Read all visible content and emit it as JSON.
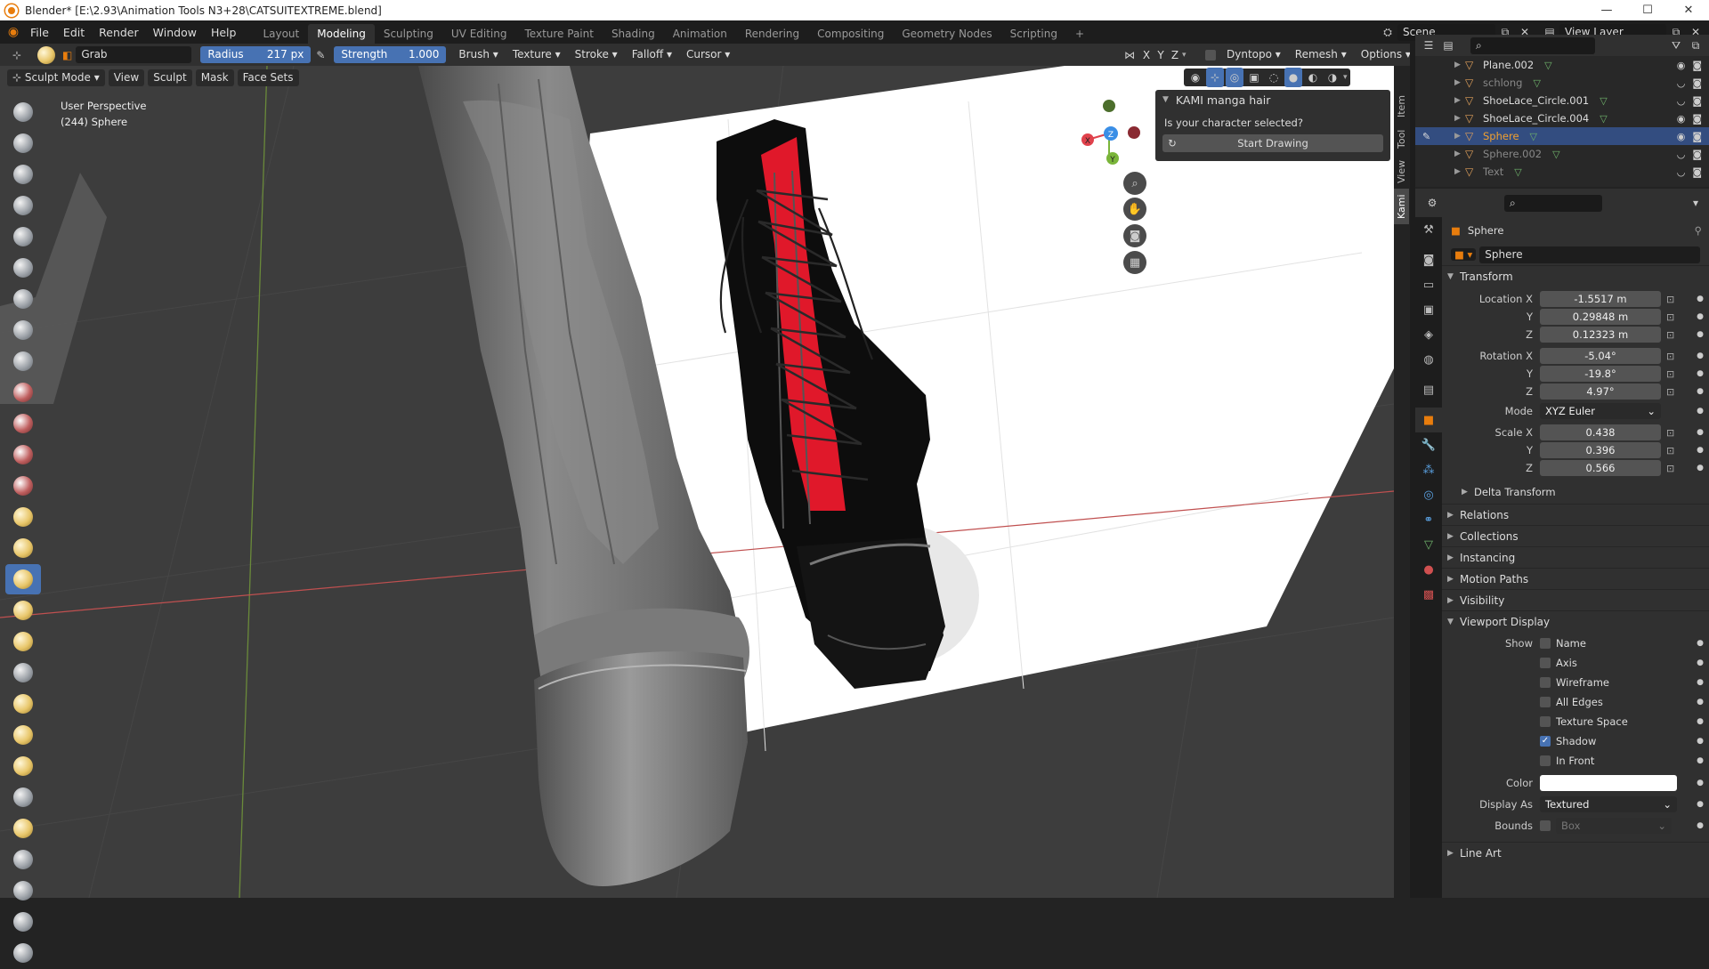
{
  "window": {
    "title": "Blender* [E:\\2.93\\Animation Tools N3+28\\CATSUITEXTREME.blend]",
    "min": "—",
    "max": "☐",
    "close": "✕"
  },
  "menus": [
    "File",
    "Edit",
    "Render",
    "Window",
    "Help"
  ],
  "workspaces": [
    "Layout",
    "Modeling",
    "Sculpting",
    "UV Editing",
    "Texture Paint",
    "Shading",
    "Animation",
    "Rendering",
    "Compositing",
    "Geometry Nodes",
    "Scripting",
    "+"
  ],
  "active_workspace": 1,
  "scene": {
    "name": "Scene",
    "view_layer": "View Layer"
  },
  "tool_header": {
    "brush_name": "Grab",
    "radius_label": "Radius",
    "radius_value": "217 px",
    "strength_label": "Strength",
    "strength_value": "1.000",
    "menus": [
      "Brush",
      "Texture",
      "Stroke",
      "Falloff",
      "Cursor"
    ],
    "axes": [
      "X",
      "Y",
      "Z"
    ],
    "right_menus": [
      "Dyntopo",
      "Remesh",
      "Options"
    ]
  },
  "mode_header": {
    "mode": "Sculpt Mode",
    "menus": [
      "View",
      "Sculpt",
      "Mask",
      "Face Sets"
    ]
  },
  "viewport": {
    "perspective": "User Perspective",
    "object_info": "(244) Sphere"
  },
  "n_panel": {
    "tabs": [
      "Item",
      "Tool",
      "View",
      "Kami"
    ],
    "active_tab": 3,
    "title": "KAMI manga hair",
    "question": "Is your character selected?",
    "button": "Start Drawing"
  },
  "gizmo": {
    "x": "X",
    "y": "Y",
    "z": "Z",
    "x_color": "#e0424c",
    "y_color": "#7ab53a",
    "z_color": "#3a8ee6"
  },
  "outliner": {
    "rows": [
      {
        "name": "Plane.002",
        "dim": false,
        "selected": false
      },
      {
        "name": "schlong",
        "dim": true,
        "selected": false
      },
      {
        "name": "ShoeLace_Circle.001",
        "dim": false,
        "selected": false
      },
      {
        "name": "ShoeLace_Circle.004",
        "dim": false,
        "selected": false
      },
      {
        "name": "Sphere",
        "dim": false,
        "selected": true
      },
      {
        "name": "Sphere.002",
        "dim": true,
        "selected": false
      },
      {
        "name": "Text",
        "dim": true,
        "selected": false
      }
    ]
  },
  "properties": {
    "object_name": "Sphere",
    "data_name": "Sphere",
    "transform_title": "Transform",
    "location": {
      "label": "Location X",
      "x": "-1.5517 m",
      "y": "0.29848 m",
      "z": "0.12323 m"
    },
    "rotation": {
      "label": "Rotation X",
      "x": "-5.04°",
      "y": "-19.8°",
      "z": "4.97°"
    },
    "mode_label": "Mode",
    "mode_value": "XYZ Euler",
    "scale": {
      "label": "Scale X",
      "x": "0.438",
      "y": "0.396",
      "z": "0.566"
    },
    "y_label": "Y",
    "z_label": "Z",
    "delta": "Delta Transform",
    "sections": [
      "Relations",
      "Collections",
      "Instancing",
      "Motion Paths",
      "Visibility"
    ],
    "viewport_display": "Viewport Display",
    "show_label": "Show",
    "show_opts": [
      {
        "label": "Name",
        "on": false
      },
      {
        "label": "Axis",
        "on": false
      },
      {
        "label": "Wireframe",
        "on": false
      },
      {
        "label": "All Edges",
        "on": false
      },
      {
        "label": "Texture Space",
        "on": false
      },
      {
        "label": "Shadow",
        "on": true
      },
      {
        "label": "In Front",
        "on": false
      }
    ],
    "color_label": "Color",
    "display_as_label": "Display As",
    "display_as_value": "Textured",
    "bounds_label": "Bounds",
    "bounds_value": "Box",
    "line_art": "Line Art"
  },
  "colors": {
    "accent": "#4772b3",
    "selected_row": "#334d80",
    "orange": "#e87d0d",
    "shoe_red": "#e0182a"
  }
}
